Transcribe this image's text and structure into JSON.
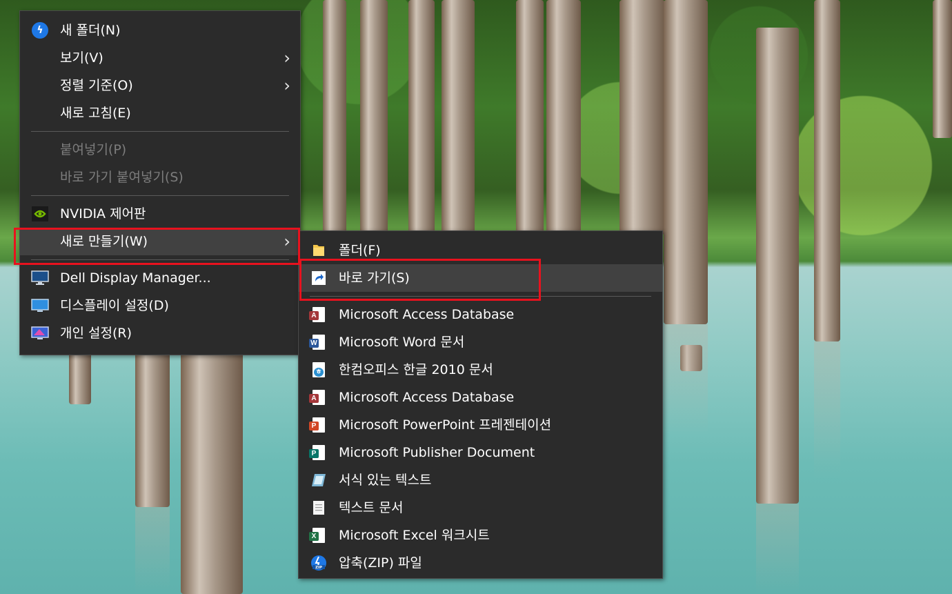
{
  "main_menu": {
    "items": [
      {
        "label": "새 폴더(N)",
        "icon": "blue-lightning-icon"
      },
      {
        "label": "보기(V)",
        "submenu": true
      },
      {
        "label": "정렬 기준(O)",
        "submenu": true
      },
      {
        "label": "새로 고침(E)"
      },
      {
        "label": "붙여넣기(P)",
        "disabled": true
      },
      {
        "label": "바로 가기 붙여넣기(S)",
        "disabled": true
      },
      {
        "label": "NVIDIA 제어판",
        "icon": "nvidia-icon"
      },
      {
        "label": "새로 만들기(W)",
        "submenu": true,
        "highlighted": true
      },
      {
        "label": "Dell Display Manager...",
        "icon": "monitor-icon"
      },
      {
        "label": "디스플레이 설정(D)",
        "icon": "display-settings-icon"
      },
      {
        "label": "개인 설정(R)",
        "icon": "personalize-icon"
      }
    ]
  },
  "sub_menu": {
    "items": [
      {
        "label": "폴더(F)",
        "icon": "folder-icon"
      },
      {
        "label": "바로 가기(S)",
        "icon": "shortcut-icon",
        "highlighted": true
      },
      {
        "label": "Microsoft Access Database",
        "icon": "access-icon"
      },
      {
        "label": "Microsoft Word 문서",
        "icon": "word-icon"
      },
      {
        "label": "한컴오피스 한글 2010 문서",
        "icon": "hwp-icon"
      },
      {
        "label": "Microsoft Access Database",
        "icon": "access-icon"
      },
      {
        "label": "Microsoft PowerPoint 프레젠테이션",
        "icon": "powerpoint-icon"
      },
      {
        "label": "Microsoft Publisher Document",
        "icon": "publisher-icon"
      },
      {
        "label": "서식 있는 텍스트",
        "icon": "rich-text-icon"
      },
      {
        "label": "텍스트 문서",
        "icon": "text-document-icon"
      },
      {
        "label": "Microsoft Excel 워크시트",
        "icon": "excel-icon"
      },
      {
        "label": "압축(ZIP) 파일",
        "icon": "zip-icon"
      }
    ]
  },
  "colors": {
    "menu_bg": "#2b2b2b",
    "hover_bg": "#414141",
    "highlight_border": "#e8121e",
    "disabled_text": "#7d7d7d"
  }
}
